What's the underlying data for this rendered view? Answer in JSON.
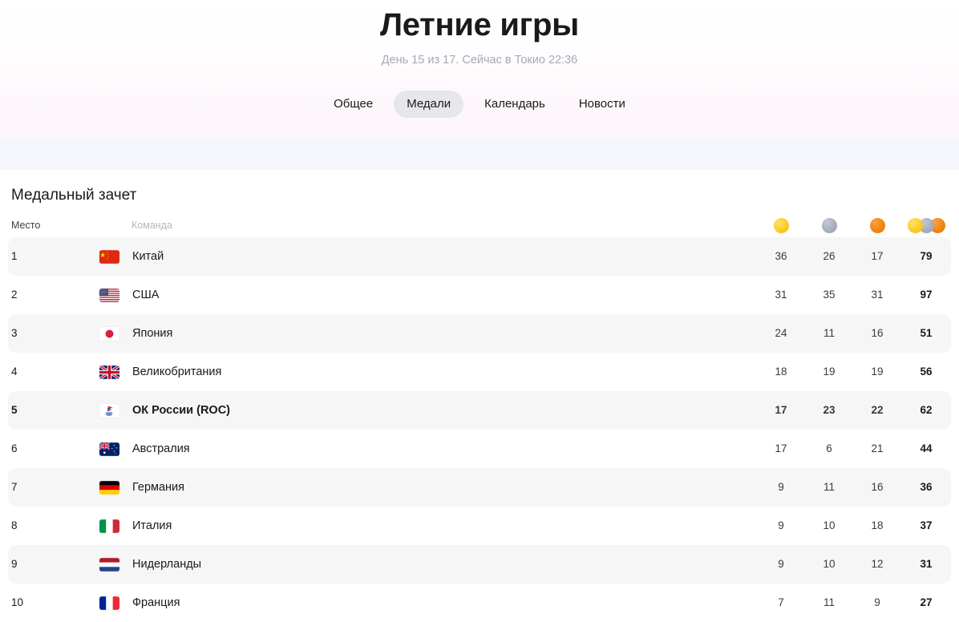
{
  "header": {
    "title": "Летние игры",
    "subtitle": "День 15 из 17. Сейчас в Токио 22:36",
    "tabs": [
      {
        "label": "Общее",
        "active": false
      },
      {
        "label": "Медали",
        "active": true
      },
      {
        "label": "Календарь",
        "active": false
      },
      {
        "label": "Новости",
        "active": false
      }
    ]
  },
  "medal_table": {
    "section_title": "Медальный зачет",
    "columns": {
      "rank": "Место",
      "team": "Команда",
      "gold_icon": "gold-medal-icon",
      "silver_icon": "silver-medal-icon",
      "bronze_icon": "bronze-medal-icon",
      "total_icon": "all-medals-icon"
    },
    "colors": {
      "gold": "#fbcd28",
      "silver": "#a8aebd",
      "bronze": "#f08516",
      "stripe": "#f6f6f7",
      "band": "#f4f6fc",
      "tab_active": "#e6e7ea"
    },
    "rows": [
      {
        "rank": "1",
        "team": "Китай",
        "flag": "cn",
        "gold": "36",
        "silver": "26",
        "bronze": "17",
        "total": "79",
        "highlight": false
      },
      {
        "rank": "2",
        "team": "США",
        "flag": "us",
        "gold": "31",
        "silver": "35",
        "bronze": "31",
        "total": "97",
        "highlight": false
      },
      {
        "rank": "3",
        "team": "Япония",
        "flag": "jp",
        "gold": "24",
        "silver": "11",
        "bronze": "16",
        "total": "51",
        "highlight": false
      },
      {
        "rank": "4",
        "team": "Великобритания",
        "flag": "gb",
        "gold": "18",
        "silver": "19",
        "bronze": "19",
        "total": "56",
        "highlight": false
      },
      {
        "rank": "5",
        "team": "ОК России (ROC)",
        "flag": "roc",
        "gold": "17",
        "silver": "23",
        "bronze": "22",
        "total": "62",
        "highlight": true
      },
      {
        "rank": "6",
        "team": "Австралия",
        "flag": "au",
        "gold": "17",
        "silver": "6",
        "bronze": "21",
        "total": "44",
        "highlight": false
      },
      {
        "rank": "7",
        "team": "Германия",
        "flag": "de",
        "gold": "9",
        "silver": "11",
        "bronze": "16",
        "total": "36",
        "highlight": false
      },
      {
        "rank": "8",
        "team": "Италия",
        "flag": "it",
        "gold": "9",
        "silver": "10",
        "bronze": "18",
        "total": "37",
        "highlight": false
      },
      {
        "rank": "9",
        "team": "Нидерланды",
        "flag": "nl",
        "gold": "9",
        "silver": "10",
        "bronze": "12",
        "total": "31",
        "highlight": false
      },
      {
        "rank": "10",
        "team": "Франция",
        "flag": "fr",
        "gold": "7",
        "silver": "11",
        "bronze": "9",
        "total": "27",
        "highlight": false
      }
    ]
  }
}
